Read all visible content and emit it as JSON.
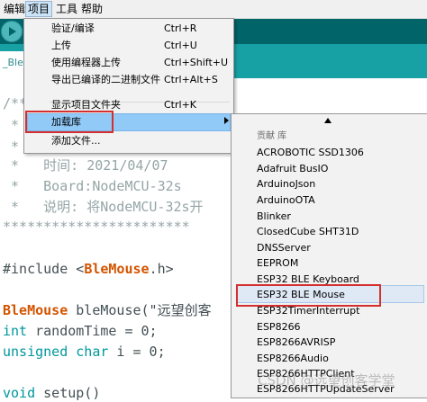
{
  "menubar": {
    "items": [
      "编辑",
      "项目",
      "工具",
      "帮助"
    ]
  },
  "tab": {
    "label": "_BleC"
  },
  "editor": {
    "lines": {
      "l1": "/**",
      "l2": " *",
      "l3": " *",
      "l4": " *   时间: 2021/04/07",
      "l5": " *   Board:NodeMCU-32s",
      "l6": " *   说明: 将NodeMCU-32s开",
      "l7": "***********************",
      "l8_a": "#include <",
      "l8_b": "BleMouse",
      "l8_c": ".h>",
      "l9_a": "BleMouse",
      "l9_b": " bleMouse(\"远望创客",
      "l10_a": "int",
      "l10_b": " randomTime = 0;",
      "l11_a": "unsigned char",
      "l11_b": " i = 0;",
      "l12_a": "void",
      "l12_b": " setup()"
    }
  },
  "menu": {
    "items": [
      {
        "label": "验证/编译",
        "shortcut": "Ctrl+R"
      },
      {
        "label": "上传",
        "shortcut": "Ctrl+U"
      },
      {
        "label": "使用编程器上传",
        "shortcut": "Ctrl+Shift+U"
      },
      {
        "label": "导出已编译的二进制文件",
        "shortcut": "Ctrl+Alt+S"
      },
      {
        "label": "显示项目文件夹",
        "shortcut": "Ctrl+K"
      },
      {
        "label": "加载库",
        "shortcut": ""
      },
      {
        "label": "添加文件...",
        "shortcut": ""
      }
    ]
  },
  "submenu": {
    "header": "贡献 库",
    "items": [
      "ACROBOTIC SSD1306",
      "Adafruit BusIO",
      "ArduinoJson",
      "ArduinoOTA",
      "Blinker",
      "ClosedCube SHT31D",
      "DNSServer",
      "EEPROM",
      "ESP32 BLE Keyboard",
      "ESP32 BLE Mouse",
      "ESP32TimerInterrupt",
      "ESP8266",
      "ESP8266AVRISP",
      "ESP8266Audio",
      "ESP8266HTTPClient",
      "ESP8266HTTPUpdateServer"
    ]
  },
  "watermark": "CSDN @远望创客学堂"
}
